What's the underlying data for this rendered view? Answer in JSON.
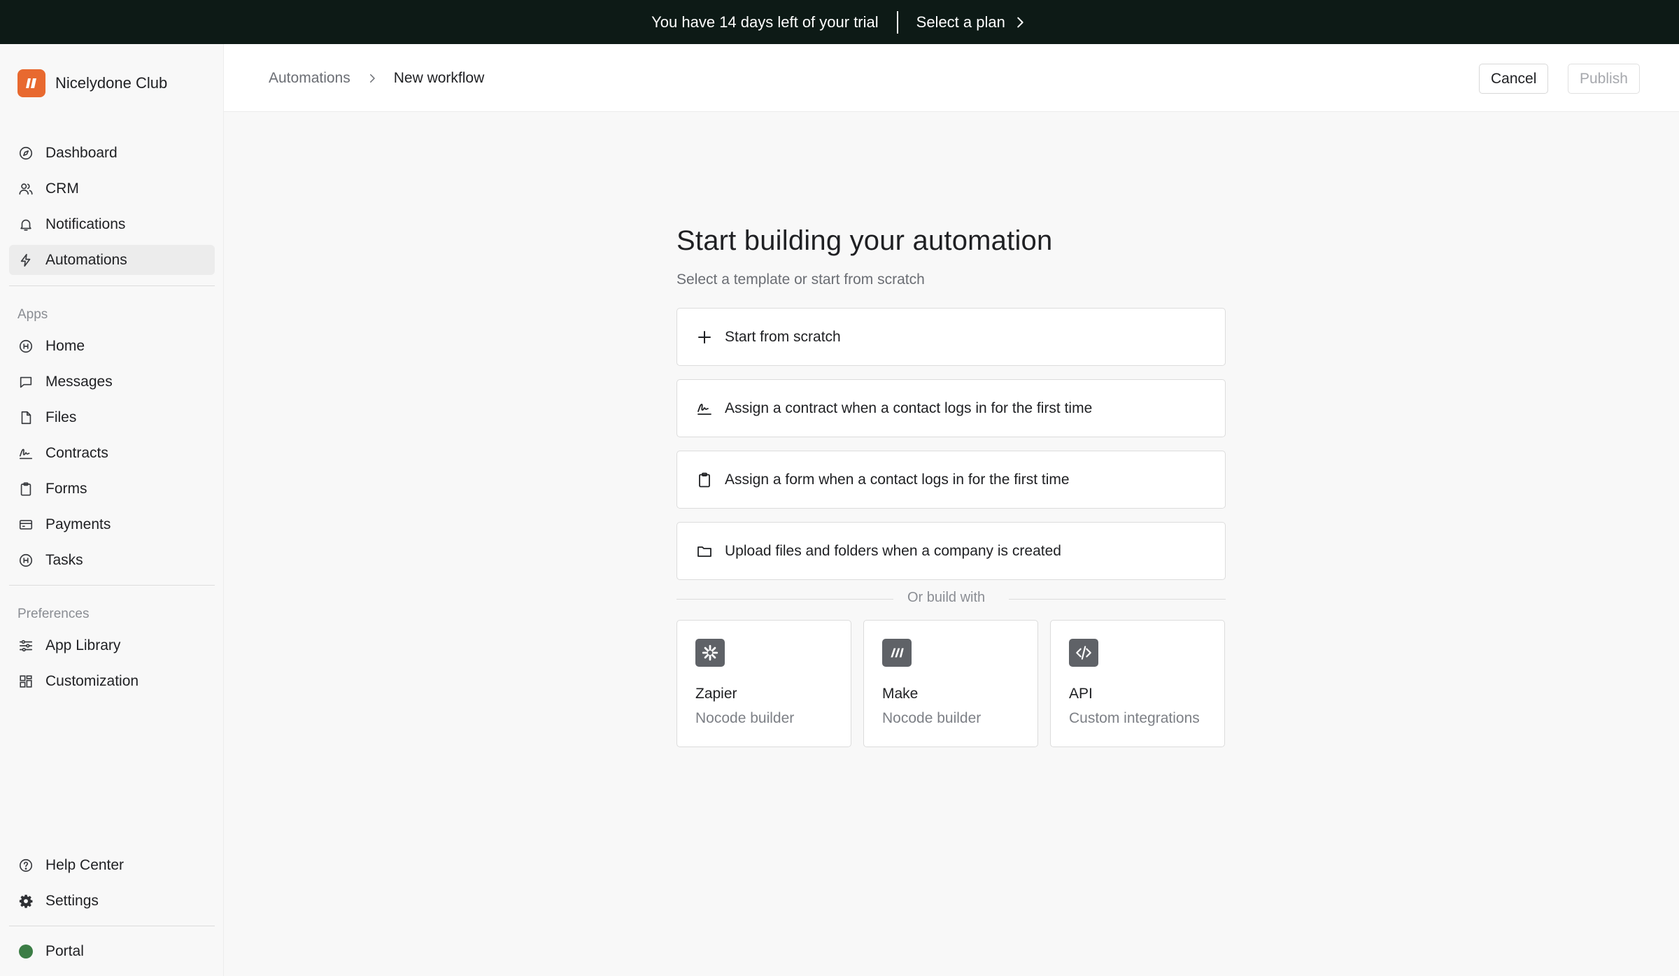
{
  "banner": {
    "trial_text": "You have 14 days left of your trial",
    "plan_link": "Select a plan"
  },
  "brand": {
    "name": "Nicelydone Club",
    "color": "#e8692f"
  },
  "sidebar": {
    "main_items": [
      {
        "label": "Dashboard",
        "icon": "compass-icon"
      },
      {
        "label": "CRM",
        "icon": "users-icon"
      },
      {
        "label": "Notifications",
        "icon": "bell-icon"
      },
      {
        "label": "Automations",
        "icon": "lightning-icon",
        "active": true
      }
    ],
    "apps_label": "Apps",
    "app_items": [
      {
        "label": "Home",
        "icon": "app-icon"
      },
      {
        "label": "Messages",
        "icon": "message-icon"
      },
      {
        "label": "Files",
        "icon": "file-icon"
      },
      {
        "label": "Contracts",
        "icon": "signature-icon"
      },
      {
        "label": "Forms",
        "icon": "clipboard-icon"
      },
      {
        "label": "Payments",
        "icon": "credit-card-icon"
      },
      {
        "label": "Tasks",
        "icon": "app-icon"
      }
    ],
    "preferences_label": "Preferences",
    "pref_items": [
      {
        "label": "App Library",
        "icon": "sliders-icon"
      },
      {
        "label": "Customization",
        "icon": "layout-icon"
      }
    ],
    "bottom_items": [
      {
        "label": "Help Center",
        "icon": "help-icon"
      },
      {
        "label": "Settings",
        "icon": "gear-icon"
      }
    ],
    "portal": {
      "label": "Portal",
      "status_color": "#3b7d45"
    }
  },
  "header": {
    "breadcrumb_parent": "Automations",
    "breadcrumb_current": "New workflow",
    "cancel_label": "Cancel",
    "publish_label": "Publish"
  },
  "main": {
    "title": "Start building your automation",
    "subtitle": "Select a template or start from scratch",
    "options": [
      {
        "label": "Start from scratch",
        "icon": "plus-icon"
      },
      {
        "label": "Assign a contract when a contact logs in for the first time",
        "icon": "signature-icon"
      },
      {
        "label": "Assign a form when a contact logs in for the first time",
        "icon": "clipboard-icon"
      },
      {
        "label": "Upload files and folders when a company is created",
        "icon": "folder-icon"
      }
    ],
    "divider_text": "Or build with",
    "builders": [
      {
        "title": "Zapier",
        "subtitle": "Nocode builder",
        "icon": "zapier-icon"
      },
      {
        "title": "Make",
        "subtitle": "Nocode builder",
        "icon": "make-icon"
      },
      {
        "title": "API",
        "subtitle": "Custom integrations",
        "icon": "code-icon"
      }
    ]
  }
}
